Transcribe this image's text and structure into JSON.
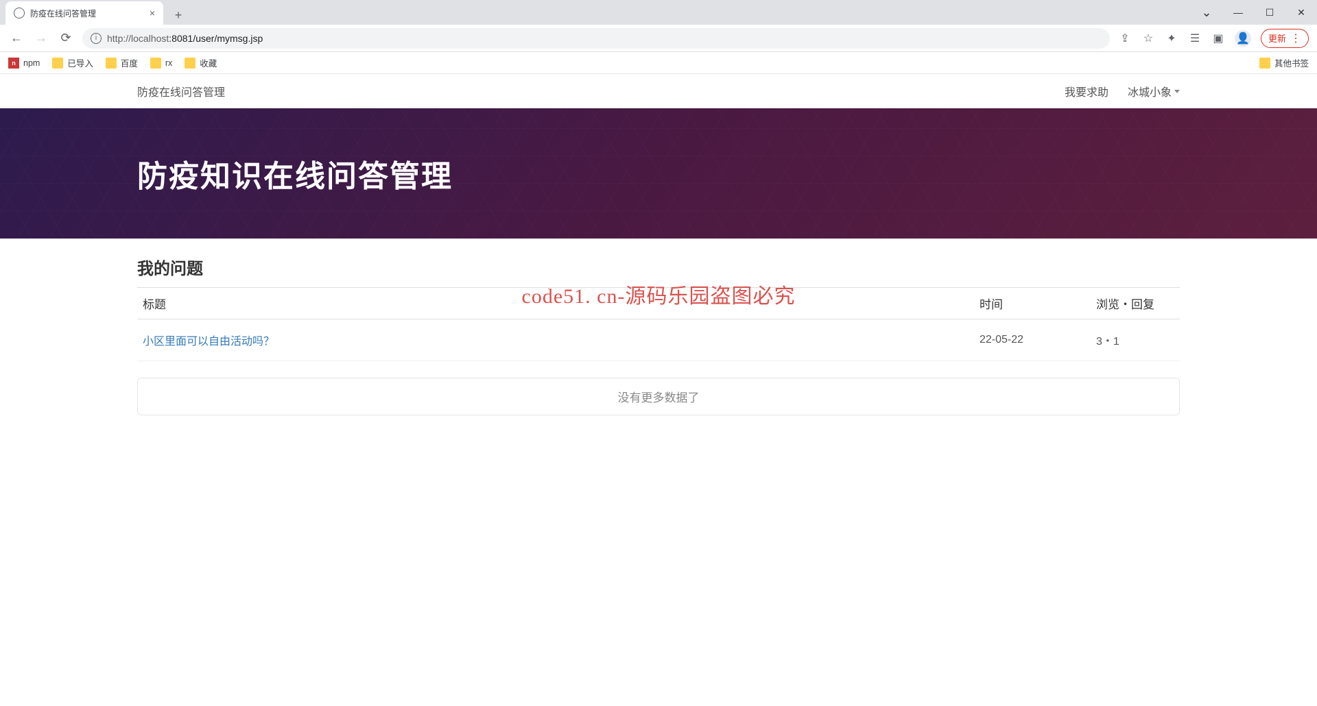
{
  "browser": {
    "tab_title": "防疫在线问答管理",
    "url_display_host": "http://localhost",
    "url_display_port_path": ":8081/user/mymsg.jsp",
    "update_label": "更新"
  },
  "bookmarks": {
    "items": [
      {
        "label": "npm",
        "icon": "npm"
      },
      {
        "label": "已导入",
        "icon": "folder"
      },
      {
        "label": "百度",
        "icon": "folder"
      },
      {
        "label": "rx",
        "icon": "folder"
      },
      {
        "label": "收藏",
        "icon": "folder"
      }
    ],
    "other_bookmarks": "其他书签"
  },
  "nav": {
    "title": "防疫在线问答管理",
    "help_link": "我要求助",
    "user_name": "冰城小象"
  },
  "hero": {
    "title": "防疫知识在线问答管理"
  },
  "section": {
    "title": "我的问题",
    "headers": {
      "title": "标题",
      "time": "时间",
      "stats": "浏览・回复"
    },
    "rows": [
      {
        "title": "小区里面可以自由活动吗？",
        "time": "22-05-22",
        "stats": "3・1"
      }
    ],
    "no_more": "没有更多数据了"
  },
  "watermark": "code51. cn-源码乐园盗图必究"
}
